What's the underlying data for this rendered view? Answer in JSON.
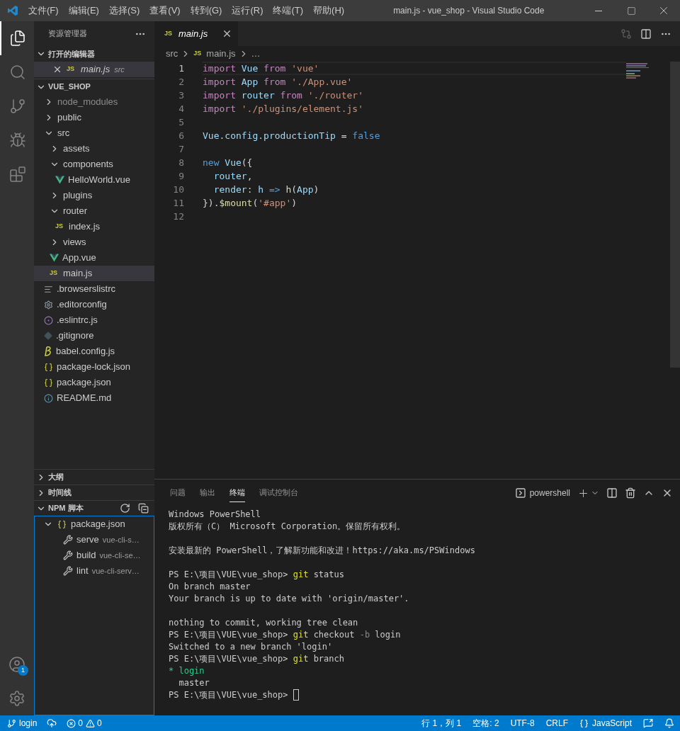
{
  "window": {
    "title": "main.js - vue_shop - Visual Studio Code"
  },
  "menu": [
    "文件(F)",
    "编辑(E)",
    "选择(S)",
    "查看(V)",
    "转到(G)",
    "运行(R)",
    "终端(T)",
    "帮助(H)"
  ],
  "activity_bar": [
    {
      "kind": "explorer",
      "selected": true
    },
    {
      "kind": "search",
      "selected": false
    },
    {
      "kind": "scm",
      "selected": false
    },
    {
      "kind": "debug",
      "selected": false
    },
    {
      "kind": "extensions",
      "selected": false
    }
  ],
  "accounts_badge": "1",
  "sidebar": {
    "title": "资源管理器",
    "open_editors": {
      "title": "打开的编辑器",
      "items": [
        {
          "name": "main.js",
          "folder": "src",
          "kind": "js",
          "icon_text": "JS"
        }
      ]
    },
    "project": {
      "title": "VUE_SHOP",
      "tree": [
        {
          "label": "node_modules",
          "kind": "folder",
          "expanded": false,
          "selected": false,
          "dimmed": true
        },
        {
          "label": "public",
          "kind": "folder",
          "expanded": false,
          "selected": false,
          "dimmed": false
        },
        {
          "label": "src",
          "kind": "folder",
          "expanded": true,
          "selected": false,
          "dimmed": false,
          "children": [
            {
              "label": "assets",
              "kind": "folder",
              "expanded": false,
              "selected": false,
              "dimmed": false
            },
            {
              "label": "components",
              "kind": "folder",
              "expanded": true,
              "selected": false,
              "dimmed": false,
              "children": [
                {
                  "label": "HelloWorld.vue",
                  "kind": "vue",
                  "selected": false,
                  "dimmed": false
                }
              ]
            },
            {
              "label": "plugins",
              "kind": "folder",
              "expanded": false,
              "selected": false,
              "dimmed": false
            },
            {
              "label": "router",
              "kind": "folder",
              "expanded": true,
              "selected": false,
              "dimmed": false,
              "children": [
                {
                  "label": "index.js",
                  "kind": "js",
                  "icon_text": "JS",
                  "selected": false,
                  "dimmed": false
                }
              ]
            },
            {
              "label": "views",
              "kind": "folder",
              "expanded": false,
              "selected": false,
              "dimmed": false
            },
            {
              "label": "App.vue",
              "kind": "vue",
              "selected": false,
              "dimmed": false
            },
            {
              "label": "main.js",
              "kind": "js",
              "icon_text": "JS",
              "selected": true,
              "dimmed": false
            }
          ]
        },
        {
          "label": ".browserslistrc",
          "kind": "lines",
          "selected": false,
          "dimmed": false
        },
        {
          "label": ".editorconfig",
          "kind": "gear",
          "selected": false,
          "dimmed": false
        },
        {
          "label": ".eslintrc.js",
          "kind": "eslint",
          "selected": false,
          "dimmed": false
        },
        {
          "label": ".gitignore",
          "kind": "git",
          "selected": false,
          "dimmed": false
        },
        {
          "label": "babel.config.js",
          "kind": "babel",
          "selected": false,
          "dimmed": false
        },
        {
          "label": "package-lock.json",
          "kind": "json",
          "selected": false,
          "dimmed": false
        },
        {
          "label": "package.json",
          "kind": "json",
          "selected": false,
          "dimmed": false
        },
        {
          "label": "README.md",
          "kind": "info",
          "selected": false,
          "dimmed": false
        }
      ]
    },
    "collapsed_sections": [
      "大纲",
      "时间线"
    ],
    "npm": {
      "title": "NPM 脚本",
      "file": "package.json",
      "scripts": [
        {
          "name": "serve",
          "command": "vue-cli-s…"
        },
        {
          "name": "build",
          "command": "vue-cli-se…"
        },
        {
          "name": "lint",
          "command": "vue-cli-serv…"
        }
      ]
    }
  },
  "editor": {
    "tab": {
      "icon_text": "JS",
      "name": "main.js"
    },
    "breadcrumbs": [
      {
        "text": "src"
      },
      {
        "text": "main.js",
        "icon_text": "JS"
      },
      {
        "text": "…"
      }
    ],
    "lines": [
      {
        "number": "1",
        "current": true,
        "tokens": [
          {
            "text": "import ",
            "kind": "kw"
          },
          {
            "text": "Vue",
            "kind": "var"
          },
          {
            "text": " from ",
            "kind": "kw"
          },
          {
            "text": "'vue'",
            "kind": "str"
          }
        ]
      },
      {
        "number": "2",
        "current": false,
        "tokens": [
          {
            "text": "import ",
            "kind": "kw"
          },
          {
            "text": "App",
            "kind": "var"
          },
          {
            "text": " from ",
            "kind": "kw"
          },
          {
            "text": "'./App.vue'",
            "kind": "str"
          }
        ]
      },
      {
        "number": "3",
        "current": false,
        "tokens": [
          {
            "text": "import ",
            "kind": "kw"
          },
          {
            "text": "router",
            "kind": "var"
          },
          {
            "text": " from ",
            "kind": "kw"
          },
          {
            "text": "'./router'",
            "kind": "str"
          }
        ]
      },
      {
        "number": "4",
        "current": false,
        "tokens": [
          {
            "text": "import ",
            "kind": "kw"
          },
          {
            "text": "'./plugins/element.js'",
            "kind": "str"
          }
        ]
      },
      {
        "number": "5",
        "current": false
      },
      {
        "number": "6",
        "current": false,
        "tokens": [
          {
            "text": "Vue.config.productionTip",
            "kind": "var"
          },
          {
            "text": " = ",
            "kind": "punc"
          },
          {
            "text": "false",
            "kind": "const"
          }
        ]
      },
      {
        "number": "7",
        "current": false
      },
      {
        "number": "8",
        "current": false,
        "tokens": [
          {
            "text": "new ",
            "kind": "const"
          },
          {
            "text": "Vue",
            "kind": "var"
          },
          {
            "text": "({",
            "kind": "punc"
          }
        ]
      },
      {
        "number": "9",
        "current": false,
        "tokens": [
          {
            "text": "  router",
            "kind": "var"
          },
          {
            "text": ",",
            "kind": "punc"
          }
        ]
      },
      {
        "number": "10",
        "current": false,
        "tokens": [
          {
            "text": "  render",
            "kind": "var"
          },
          {
            "text": ": ",
            "kind": "punc"
          },
          {
            "text": "h",
            "kind": "var"
          },
          {
            "text": " => ",
            "kind": "const"
          },
          {
            "text": "h",
            "kind": "fn"
          },
          {
            "text": "(",
            "kind": "punc"
          },
          {
            "text": "App",
            "kind": "var"
          },
          {
            "text": ")",
            "kind": "punc"
          }
        ]
      },
      {
        "number": "11",
        "current": false,
        "tokens": [
          {
            "text": "}).",
            "kind": "punc"
          },
          {
            "text": "$mount",
            "kind": "fn"
          },
          {
            "text": "(",
            "kind": "punc"
          },
          {
            "text": "'#app'",
            "kind": "str"
          },
          {
            "text": ")",
            "kind": "punc"
          }
        ]
      },
      {
        "number": "12",
        "current": false
      }
    ]
  },
  "panel": {
    "tabs": [
      {
        "label": "问题",
        "selected": false
      },
      {
        "label": "输出",
        "selected": false
      },
      {
        "label": "终端",
        "selected": true
      },
      {
        "label": "调试控制台",
        "selected": false
      }
    ],
    "shell": "powershell",
    "terminal": [
      {
        "kind": "text",
        "segments": [
          {
            "text": "Windows PowerShell",
            "kind": "plain"
          }
        ]
      },
      {
        "kind": "text",
        "segments": [
          {
            "text": "版权所有（C） Microsoft Corporation。保留所有权利。",
            "kind": "plain"
          }
        ]
      },
      {
        "kind": "blank"
      },
      {
        "kind": "text",
        "segments": [
          {
            "text": "安装最新的 PowerShell，了解新功能和改进！https://aka.ms/PSWindows",
            "kind": "plain"
          }
        ]
      },
      {
        "kind": "blank"
      },
      {
        "kind": "text",
        "segments": [
          {
            "text": "PS E:\\项目\\VUE\\vue_shop> ",
            "kind": "plain"
          },
          {
            "text": "git",
            "kind": "cmd"
          },
          {
            "text": " status",
            "kind": "plain"
          }
        ]
      },
      {
        "kind": "text",
        "segments": [
          {
            "text": "On branch master",
            "kind": "plain"
          }
        ]
      },
      {
        "kind": "text",
        "segments": [
          {
            "text": "Your branch is up to date with 'origin/master'.",
            "kind": "plain"
          }
        ]
      },
      {
        "kind": "blank"
      },
      {
        "kind": "text",
        "segments": [
          {
            "text": "nothing to commit, working tree clean",
            "kind": "plain"
          }
        ]
      },
      {
        "kind": "text",
        "segments": [
          {
            "text": "PS E:\\项目\\VUE\\vue_shop> ",
            "kind": "plain"
          },
          {
            "text": "git",
            "kind": "cmd"
          },
          {
            "text": " checkout ",
            "kind": "plain"
          },
          {
            "text": "-b",
            "kind": "flag"
          },
          {
            "text": " login",
            "kind": "plain"
          }
        ]
      },
      {
        "kind": "text",
        "segments": [
          {
            "text": "Switched to a new branch 'login'",
            "kind": "plain"
          }
        ]
      },
      {
        "kind": "text",
        "segments": [
          {
            "text": "PS E:\\项目\\VUE\\vue_shop> ",
            "kind": "plain"
          },
          {
            "text": "git",
            "kind": "cmd"
          },
          {
            "text": " branch",
            "kind": "plain"
          }
        ]
      },
      {
        "kind": "text",
        "segments": [
          {
            "text": "* login",
            "kind": "green"
          }
        ]
      },
      {
        "kind": "text",
        "segments": [
          {
            "text": "  master",
            "kind": "plain"
          }
        ]
      },
      {
        "kind": "text",
        "cursor": true,
        "segments": [
          {
            "text": "PS E:\\项目\\VUE\\vue_shop> ",
            "kind": "plain"
          }
        ]
      }
    ]
  },
  "status_bar": {
    "branch": "login",
    "errors": "0",
    "warnings": "0",
    "right": [
      {
        "text": "行 1，列 1",
        "kind": "text"
      },
      {
        "text": "空格: 2",
        "kind": "text"
      },
      {
        "text": "UTF-8",
        "kind": "text"
      },
      {
        "text": "CRLF",
        "kind": "text"
      },
      {
        "text": "JavaScript",
        "kind": "language"
      }
    ]
  }
}
